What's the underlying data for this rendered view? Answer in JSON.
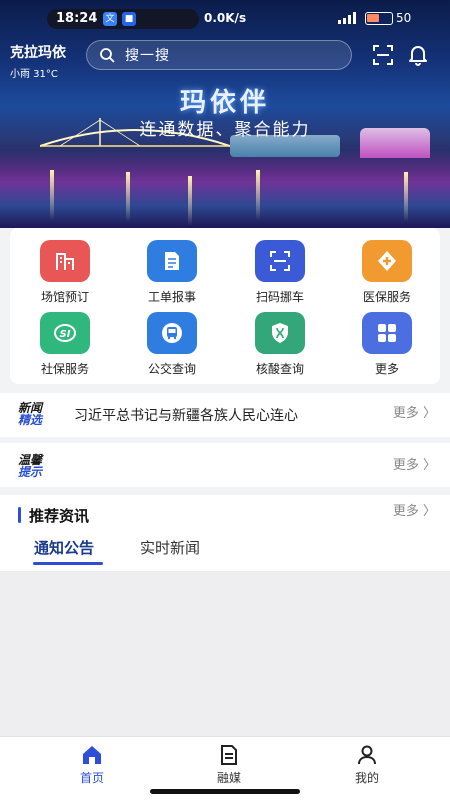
{
  "status_bar": {
    "time": "18:24",
    "app_badges": [
      "文",
      "■"
    ],
    "network_speed": "0.0K/s",
    "battery": "50"
  },
  "header": {
    "city": "克拉玛依",
    "weather": "小雨  31°C",
    "search_placeholder": "搜一搜"
  },
  "banner": {
    "title": "玛依伴",
    "subtitle": "连通数据、聚合能力"
  },
  "services": [
    {
      "label": "场馆预订",
      "icon": "building-icon",
      "color": "#e85656"
    },
    {
      "label": "工单报事",
      "icon": "document-icon",
      "color": "#2f7de1"
    },
    {
      "label": "扫码挪车",
      "icon": "scan-icon",
      "color": "#3b5bd6"
    },
    {
      "label": "医保服务",
      "icon": "medical-plus-icon",
      "color": "#f19a2f"
    },
    {
      "label": "社保服务",
      "icon": "social-security-icon",
      "color": "#2fb77d"
    },
    {
      "label": "公交查询",
      "icon": "bus-icon",
      "color": "#2f7de1"
    },
    {
      "label": "核酸查询",
      "icon": "dna-shield-icon",
      "color": "#33a67a"
    },
    {
      "label": "更多",
      "icon": "grid-icon",
      "color": "#4b6fe0"
    }
  ],
  "news": {
    "tag_top": "新闻",
    "tag_bottom": "精选",
    "headline": "习近平总书记与新疆各族人民心连心",
    "more": "更多 〉"
  },
  "tips": {
    "tag_top": "温馨",
    "tag_bottom": "提示",
    "more": "更多 〉"
  },
  "recommend": {
    "title": "推荐资讯",
    "more": "更多 〉",
    "tabs": [
      "通知公告",
      "实时新闻"
    ],
    "active_tab": "通知公告"
  },
  "bottom_nav": [
    {
      "label": "首页",
      "icon": "home-icon",
      "active": true
    },
    {
      "label": "融媒",
      "icon": "media-icon",
      "active": false
    },
    {
      "label": "我的",
      "icon": "profile-icon",
      "active": false
    }
  ]
}
